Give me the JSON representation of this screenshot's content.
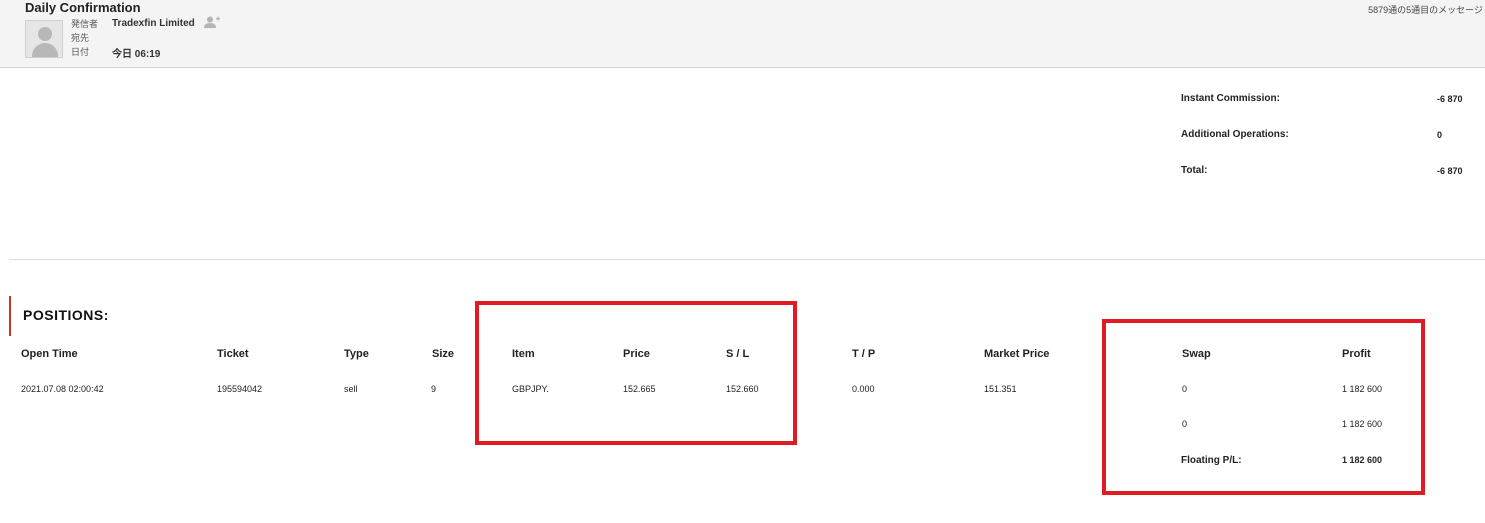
{
  "mail": {
    "subject": "Daily Confirmation",
    "from_label": "発信者",
    "from_value": "Tradexfin Limited",
    "to_label": "宛先",
    "to_value": "",
    "date_label": "日付",
    "date_value": "今日 06:19",
    "message_count": "5879通の5通目のメッセージ"
  },
  "summary": {
    "instant_commission_label": "Instant Commission:",
    "instant_commission_value": "-6 870",
    "additional_operations_label": "Additional Operations:",
    "additional_operations_value": "0",
    "total_label": "Total:",
    "total_value": "-6 870"
  },
  "positions": {
    "title": "POSITIONS:",
    "headers": [
      "Open Time",
      "Ticket",
      "Type",
      "Size",
      "Item",
      "Price",
      "S / L",
      "T / P",
      "Market Price",
      "Swap",
      "Profit"
    ],
    "row": [
      "2021.07.08 02:00:42",
      "195594042",
      "sell",
      "9",
      "GBPJPY.",
      "152.665",
      "152.660",
      "0.000",
      "151.351",
      "0",
      "1 182 600"
    ],
    "subtotal_swap": "0",
    "subtotal_profit": "1 182 600",
    "floating_label": "Floating P/L:",
    "floating_value": "1 182 600"
  },
  "colors": {
    "highlight": "#e01b24",
    "accent_bar": "#c0392b"
  },
  "icons": {
    "avatar": "avatar-placeholder-icon",
    "add_contact": "add-contact-icon"
  }
}
